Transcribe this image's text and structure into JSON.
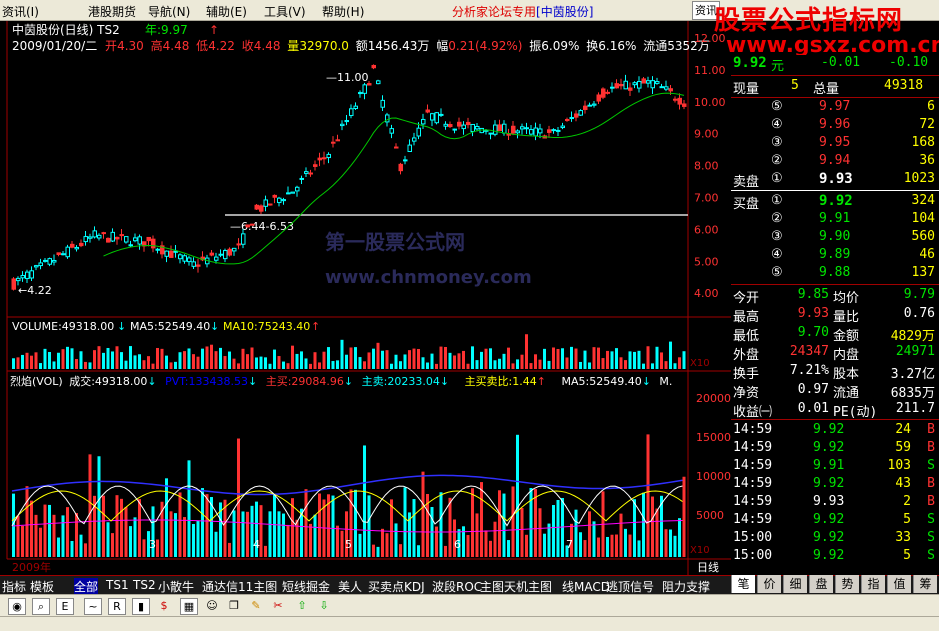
{
  "menu": {
    "items": [
      "资讯(I)",
      "港股期货",
      "导航(N)",
      "辅助(E)",
      "工具(V)",
      "帮助(H)"
    ],
    "promo": "分析家论坛专用",
    "promo_stock": "[中茵股份]",
    "top_button": "资讯"
  },
  "watermark": {
    "title": "股票公式指标网",
    "url": "www.gsxz.com.cn"
  },
  "chart_overlay_watermark": {
    "line1": "第一股票公式网",
    "line2": "www.chnmoney.com"
  },
  "main_chart": {
    "title": "中茵股份(日线) TS2",
    "year_label": "年:9.97",
    "info": {
      "date": "2009/01/20/二",
      "open_label": "开",
      "open": "4.30",
      "high_label": "高",
      "high": "4.48",
      "low_label": "低",
      "low": "4.22",
      "close_label": "收",
      "close": "4.48",
      "volume_label": "量",
      "volume": "32970.0",
      "amount_label": "额",
      "amount": "1456.43万",
      "range_label": "幅",
      "range": "0.21(4.92%)",
      "amplitude_label": "振",
      "amplitude": "6.09%",
      "turnover_label": "换",
      "turnover": "6.16%",
      "float_label": "流通",
      "float": "5352万"
    },
    "price_axis": [
      "12.00",
      "11.00",
      "10.00",
      "9.00",
      "8.00",
      "7.00",
      "6.00",
      "5.00",
      "4.00"
    ],
    "annotations": {
      "high_mark": "11.00",
      "low_mark": "4.22",
      "range_mark": "6.44-6.53"
    }
  },
  "volume_panel": {
    "label": "VOLUME:49318.00",
    "ma5": "MA5:52549.40",
    "ma10": "MA10:75243.40",
    "scale": "X10"
  },
  "vol_indicator": {
    "name": "烈焰(VOL)",
    "deal": "成交:49318.00",
    "pvt": "PVT:133438.53",
    "main_buy": "主买:29084.96",
    "main_sell": "主卖:20233.04",
    "ratio": "主买卖比:1.44",
    "ma5": "MA5:52549.40",
    "more": "M.",
    "axis": [
      "20000",
      "15000",
      "10000",
      "5000"
    ],
    "scale": "X10"
  },
  "x_axis": {
    "year": "2009年",
    "months": [
      "3",
      "4",
      "5",
      "6",
      "7"
    ],
    "period": "日线"
  },
  "quote": {
    "current_price": "9.92",
    "unit": "元",
    "change1": "-0.01",
    "change2": "-0.10",
    "xianshou_label": "现量",
    "xianshou": "5",
    "zongliang_label": "总量",
    "zongliang": "49318",
    "sell": [
      {
        "level": "⑤",
        "price": "9.97",
        "vol": "6"
      },
      {
        "level": "④",
        "price": "9.96",
        "vol": "72"
      },
      {
        "level": "③",
        "price": "9.95",
        "vol": "168"
      },
      {
        "level": "②",
        "price": "9.94",
        "vol": "36"
      },
      {
        "label": "卖盘",
        "level": "①",
        "price": "9.93",
        "vol": "1023"
      }
    ],
    "buy": [
      {
        "label": "买盘",
        "level": "①",
        "price": "9.92",
        "vol": "324"
      },
      {
        "level": "②",
        "price": "9.91",
        "vol": "104"
      },
      {
        "level": "③",
        "price": "9.90",
        "vol": "560"
      },
      {
        "level": "④",
        "price": "9.89",
        "vol": "46"
      },
      {
        "level": "⑤",
        "price": "9.88",
        "vol": "137"
      }
    ],
    "stats": [
      {
        "l1": "今开",
        "v1": "9.85",
        "l2": "均价",
        "v2": "9.79"
      },
      {
        "l1": "最高",
        "v1": "9.93",
        "l2": "量比",
        "v2": "0.76"
      },
      {
        "l1": "最低",
        "v1": "9.70",
        "l2": "金额",
        "v2": "4829万"
      },
      {
        "l1": "外盘",
        "v1": "24347",
        "l2": "内盘",
        "v2": "24971"
      },
      {
        "l1": "换手",
        "v1": "7.21%",
        "l2": "股本",
        "v2": "3.27亿"
      },
      {
        "l1": "净资",
        "v1": "0.97",
        "l2": "流通",
        "v2": "6835万"
      },
      {
        "l1": "收益㈠",
        "v1": "0.01",
        "l2": "PE(动)",
        "v2": "211.7"
      }
    ],
    "ticks": [
      {
        "time": "14:59",
        "price": "9.92",
        "vol": "24",
        "bs": "B"
      },
      {
        "time": "14:59",
        "price": "9.92",
        "vol": "59",
        "bs": "B"
      },
      {
        "time": "14:59",
        "price": "9.91",
        "vol": "103",
        "bs": "S"
      },
      {
        "time": "14:59",
        "price": "9.92",
        "vol": "43",
        "bs": "B"
      },
      {
        "time": "14:59",
        "price": "9.93",
        "vol": "2",
        "bs": "B"
      },
      {
        "time": "14:59",
        "price": "9.92",
        "vol": "5",
        "bs": "S"
      },
      {
        "time": "15:00",
        "price": "9.92",
        "vol": "33",
        "bs": "S"
      },
      {
        "time": "15:00",
        "price": "9.92",
        "vol": "5",
        "bs": "S"
      }
    ]
  },
  "tabs": [
    "指标",
    "模板",
    "全部",
    "TS1",
    "TS2",
    "小散牛",
    "通达信11主图",
    "短线掘金",
    "美人",
    "买卖点KDJ",
    "波段ROC",
    "主图天机主图",
    "线MACD",
    "逃顶信号",
    "阻力支撑"
  ],
  "right_tabs": [
    "笔",
    "价",
    "细",
    "盘",
    "势",
    "指",
    "值",
    "筹"
  ],
  "colors": {
    "up": "#ff3232",
    "down": "#00ffff",
    "axis": "#a00000",
    "ma": "#00c800"
  }
}
